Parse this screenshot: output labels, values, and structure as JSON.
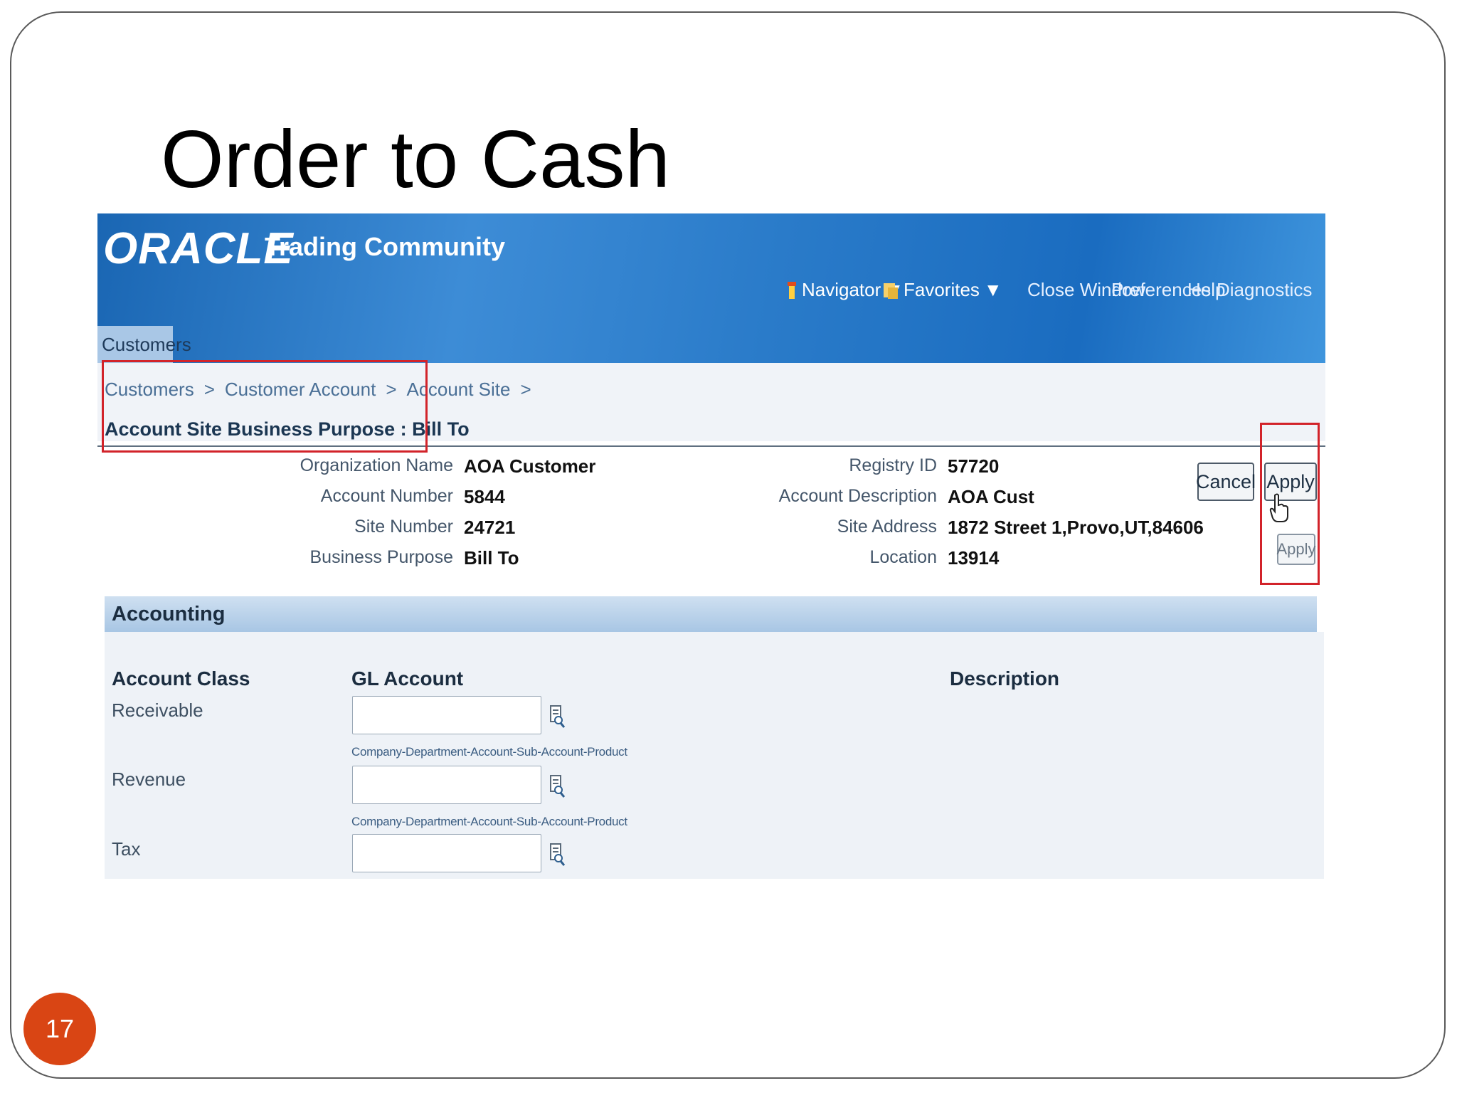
{
  "slide": {
    "title": "Order to Cash",
    "page_number": "17"
  },
  "app": {
    "logo": "ORACLE",
    "name": "Trading Community",
    "global_nav": {
      "navigator": "Navigator",
      "favorites": "Favorites",
      "close_window": "Close Window",
      "preferences": "Preferences",
      "help": "Help",
      "diagnostics": "Diagnostics"
    },
    "tab": "Customers"
  },
  "breadcrumb": {
    "items": [
      "Customers",
      "Customer Account",
      "Account Site"
    ],
    "separator": ">"
  },
  "page_title": "Account Site Business Purpose : Bill To",
  "info_left": [
    {
      "label": "Organization Name",
      "value": "AOA Customer"
    },
    {
      "label": "Account Number",
      "value": "5844"
    },
    {
      "label": "Site Number",
      "value": "24721"
    },
    {
      "label": "Business Purpose",
      "value": "Bill To"
    }
  ],
  "info_right": [
    {
      "label": "Registry ID",
      "value": "57720"
    },
    {
      "label": "Account Description",
      "value": "AOA Cust"
    },
    {
      "label": "Site Address",
      "value": "1872 Street 1,Provo,UT,84606"
    },
    {
      "label": "Location",
      "value": "13914"
    }
  ],
  "buttons": {
    "cancel": "Cancel",
    "apply": "Apply",
    "apply_tooltip": "Apply"
  },
  "accounting": {
    "section_title": "Accounting",
    "columns": {
      "account_class": "Account Class",
      "gl_account": "GL Account",
      "description": "Description"
    },
    "rows": [
      {
        "class": "Receivable",
        "value": "",
        "hint": "Company-Department-Account-Sub-Account-Product"
      },
      {
        "class": "Revenue",
        "value": "",
        "hint": "Company-Department-Account-Sub-Account-Product"
      },
      {
        "class": "Tax",
        "value": ""
      }
    ]
  },
  "colors": {
    "banner": "#2a7bc9",
    "highlight_box": "#d2232a",
    "page_number_badge": "#d94514"
  }
}
